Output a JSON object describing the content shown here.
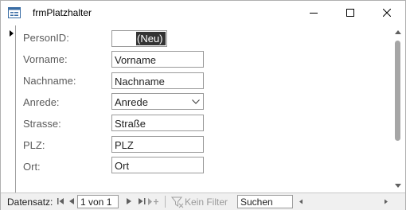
{
  "window": {
    "title": "frmPlatzhalter",
    "app_icon": "form-icon",
    "controls": {
      "minimize_icon": "minimize-icon",
      "maximize_icon": "maximize-icon",
      "close_icon": "close-icon"
    }
  },
  "form": {
    "fields": [
      {
        "label": "PersonID:",
        "value": "(Neu)"
      },
      {
        "label": "Vorname:",
        "value": "Vorname"
      },
      {
        "label": "Nachname:",
        "value": "Nachname"
      },
      {
        "label": "Anrede:",
        "value": "Anrede"
      },
      {
        "label": "Strasse:",
        "value": "Straße"
      },
      {
        "label": "PLZ:",
        "value": "PLZ"
      },
      {
        "label": "Ort:",
        "value": "Ort"
      }
    ]
  },
  "navigation": {
    "label": "Datensatz:",
    "position": "1 von 1",
    "filter_label": "Kein Filter",
    "search_value": "Suchen"
  },
  "colors": {
    "title_accent": "#9b2a55",
    "selection": "#333333",
    "label_text": "#5b5b5b"
  }
}
